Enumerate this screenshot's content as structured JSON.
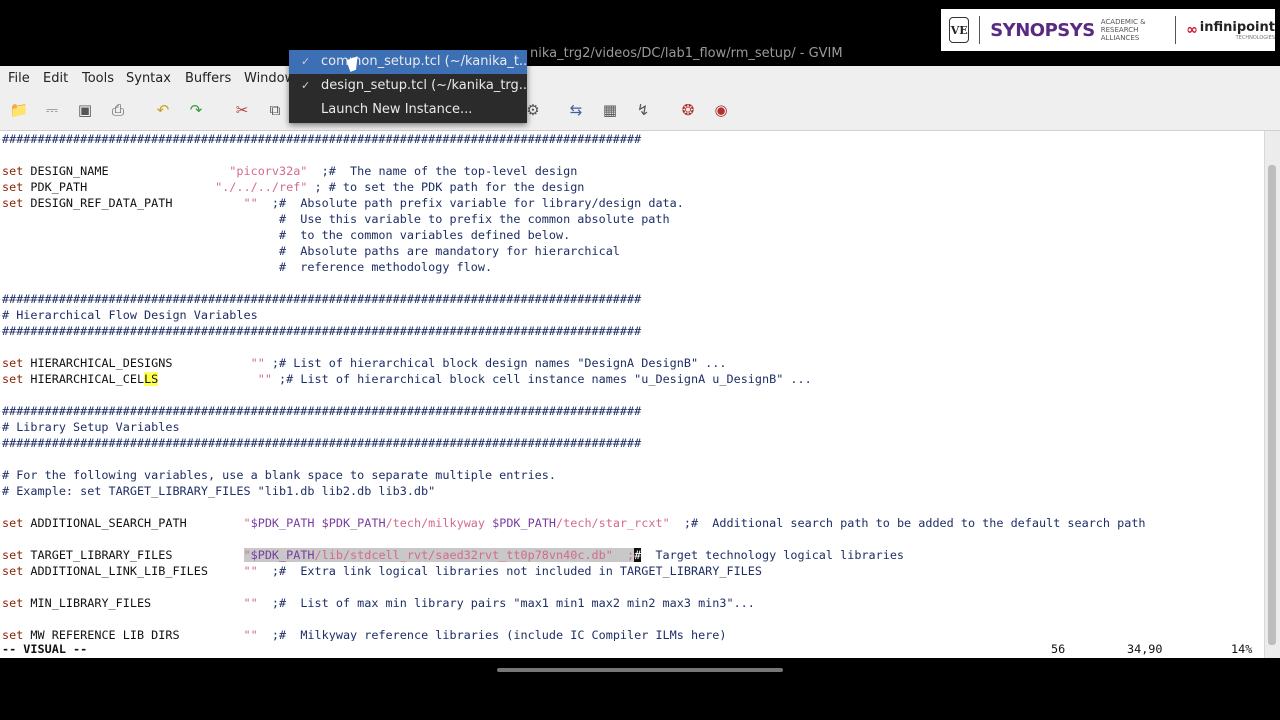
{
  "window": {
    "title_fragment": "nika_trg2/videos/DC/lab1_flow/rm_setup/ - GVIM"
  },
  "logos": {
    "vlsi": "VE",
    "synopsys": "SYNOPSYS",
    "academic": "ACADEMIC & RESEARCH ALLIANCES",
    "infinipoint": "infinipoint",
    "infinipoint_sub": "TECHNOLOGIES"
  },
  "menu": [
    "File",
    "Edit",
    "Tools",
    "Syntax",
    "Buffers",
    "Window"
  ],
  "toolbar_icons": [
    "open-file-icon",
    "save-file-icon",
    "save-all-icon",
    "print-icon",
    "undo-icon",
    "redo-icon",
    "cut-icon",
    "copy-icon",
    "paste-icon",
    "find-replace-icon",
    "find-next-icon",
    "find-prev-icon",
    "load-session-icon",
    "save-session-icon",
    "run-script-icon",
    "make-icon",
    "ctags-icon",
    "help-icon",
    "find-help-icon"
  ],
  "popup": {
    "items": [
      {
        "icon": "vim-icon",
        "label": "common_setup.tcl (~/kanika_t...",
        "selected": true
      },
      {
        "icon": "vim-icon",
        "label": "design_setup.tcl (~/kanika_trg...",
        "selected": false
      },
      {
        "icon": "",
        "label": "Launch New Instance...",
        "selected": false
      }
    ]
  },
  "code": {
    "sep": "##########################################################################################",
    "design_name": {
      "kw": "set",
      "name": " DESIGN_NAME                 ",
      "val": "\"picorv32a\"",
      "rest": "  ;#  The name of the top-level design"
    },
    "pdk_path": {
      "kw": "set",
      "name": " PDK_PATH                  ",
      "val": "\"./../../ref\"",
      "rest": " ; # to set the PDK path for the design"
    },
    "design_ref": {
      "kw": "set",
      "name": " DESIGN_REF_DATA_PATH          ",
      "val": "\"\"",
      "rest": "  ;#  Absolute path prefix variable for library/design data."
    },
    "design_ref_c1": "                                       #  Use this variable to prefix the common absolute path",
    "design_ref_c2": "                                       #  to the common variables defined below.",
    "design_ref_c3": "                                       #  Absolute paths are mandatory for hierarchical",
    "design_ref_c4": "                                       #  reference methodology flow.",
    "hier_header": "# Hierarchical Flow Design Variables",
    "hier_designs": {
      "kw": "set",
      "name": " HIERARCHICAL_DESIGNS           ",
      "val": "\"\"",
      "rest": " ;# List of hierarchical block design names \"DesignA DesignB\" ..."
    },
    "hier_cells_a": " HIERARCHICAL_CEL",
    "hier_cells_b": "LS",
    "hier_cells_c": "              ",
    "hier_cells_val": "\"\"",
    "hier_cells_rest": " ;# List of hierarchical block cell instance names \"u_DesignA u_DesignB\" ...",
    "lib_header": "# Library Setup Variables",
    "lib_c1": "# For the following variables, use a blank space to separate multiple entries.",
    "lib_c2": "# Example: set TARGET_LIBRARY_FILES \"lib1.db lib2.db lib3.db\"",
    "add_search": {
      "kw": "set",
      "name": " ADDITIONAL_SEARCH_PATH        ",
      "q1": "\"",
      "v1": "$PDK_PATH",
      "t1": " ",
      "v2": "$PDK_PATH",
      "t2": "/tech/milkyway ",
      "v3": "$PDK_PATH",
      "t3": "/tech/star_rcxt\"",
      "rest": "  ;#  Additional search path to be added to the default search path"
    },
    "target_lib": {
      "kw": "set",
      "name": " TARGET_LIBRARY_FILES          ",
      "sel1": "\"",
      "sel_var": "$PDK_PATH",
      "sel2": "/lib/stdcell_rvt/saed32rvt_tt0p78vn40c.db\"  ;",
      "cur": "#",
      "rest": "  Target technology logical libraries"
    },
    "add_link": {
      "kw": "set",
      "name": " ADDITIONAL_LINK_LIB_FILES     ",
      "val": "\"\"",
      "rest": "  ;#  Extra link logical libraries not included in TARGET_LIBRARY_FILES"
    },
    "min_lib": {
      "kw": "set",
      "name": " MIN_LIBRARY_FILES             ",
      "val": "\"\"",
      "rest": "  ;#  List of max min library pairs \"max1 min1 max2 min2 max3 min3\"..."
    },
    "mw_ref": {
      "kw": "set",
      "name": " MW_REFERENCE_LIB_DIRS         ",
      "val": "\"\"",
      "rest": "  ;#  Milkyway reference libraries (include IC Compiler ILMs here)"
    }
  },
  "status": {
    "mode": "-- VISUAL --",
    "count": "56",
    "position": "34,90",
    "percent": "14%"
  }
}
